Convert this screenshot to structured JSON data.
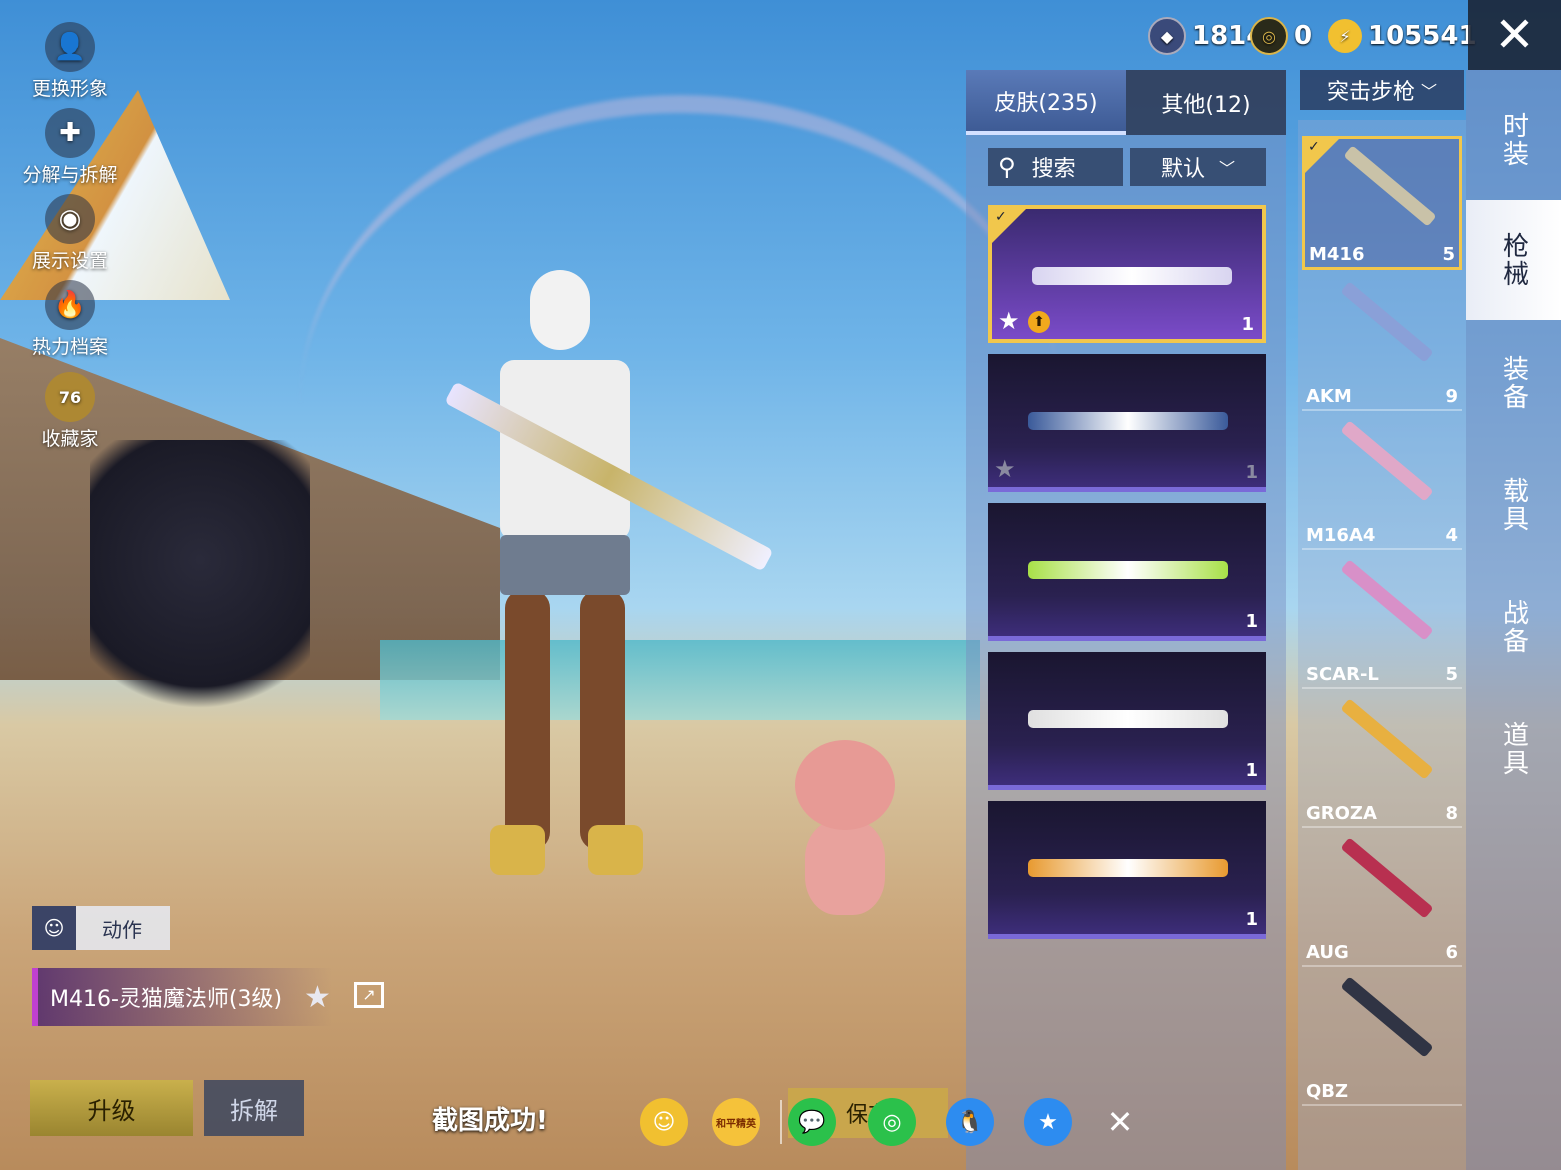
{
  "currency": {
    "coin_a": "1814",
    "coin_b": "0",
    "coin_c": "105541"
  },
  "left_menu": [
    {
      "label": "更换形象",
      "icon": "avatar-icon"
    },
    {
      "label": "分解与拆解",
      "icon": "puzzle-icon"
    },
    {
      "label": "展示设置",
      "icon": "eye-icon"
    },
    {
      "label": "热力档案",
      "icon": "flame-icon"
    },
    {
      "label": "收藏家",
      "icon": "badge-icon",
      "badge": "76"
    }
  ],
  "tabs": {
    "skins": "皮肤(235)",
    "others": "其他(12)"
  },
  "search": {
    "label": "搜索"
  },
  "sort": {
    "label": "默认"
  },
  "weapon_filter": "突击步枪",
  "categories": [
    "时装",
    "枪械",
    "装备",
    "载具",
    "战备",
    "道具"
  ],
  "weapons": [
    {
      "name": "M416",
      "count": "5",
      "color": "#c9c2a8"
    },
    {
      "name": "AKM",
      "count": "9",
      "color": "#8aa0d8"
    },
    {
      "name": "M16A4",
      "count": "4",
      "color": "#e0a8c8"
    },
    {
      "name": "SCAR-L",
      "count": "5",
      "color": "#d890c8"
    },
    {
      "name": "GROZA",
      "count": "8",
      "color": "#e8b040"
    },
    {
      "name": "AUG",
      "count": "6",
      "color": "#b83050"
    },
    {
      "name": "QBZ",
      "count": "",
      "color": "#303444"
    }
  ],
  "skins": [
    {
      "count": "1",
      "color": "#d8d4f0"
    },
    {
      "count": "1",
      "color": "#3a5a9a"
    },
    {
      "count": "1",
      "color": "#a8e048"
    },
    {
      "count": "1",
      "color": "#e0e0e0"
    },
    {
      "count": "1",
      "color": "#e89a30"
    }
  ],
  "action_label": "动作",
  "skin_name": "M416-灵猫魔法师(3级)",
  "buttons": {
    "upgrade": "升级",
    "disassemble": "拆解",
    "save": "保存"
  },
  "toast": "截图成功!",
  "share_targets": [
    "wegame-icon",
    "game-logo-icon",
    "wechat-icon",
    "moments-icon",
    "qq-icon",
    "qzone-icon",
    "close-icon"
  ],
  "share_logo_text": "和平精英"
}
